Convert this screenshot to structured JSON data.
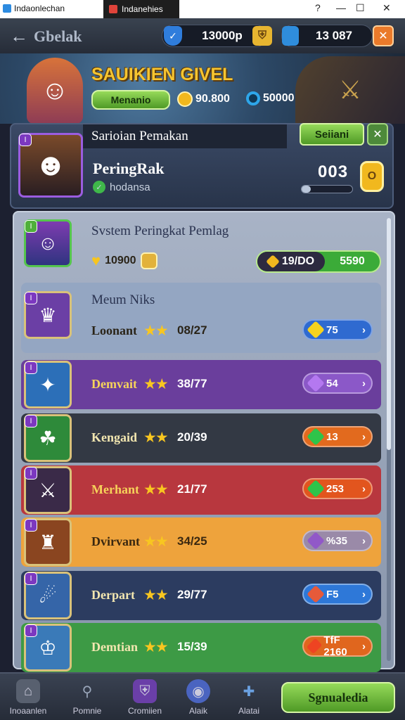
{
  "window": {
    "app_title": "Indaonlechan",
    "tab_title": "Indanehies",
    "help": "?",
    "minimize": "—",
    "maximize": "☐",
    "close": "✕"
  },
  "topbar": {
    "back_label": "Gbelak",
    "currency1": "13000p",
    "currency2": "13 087",
    "plus": "+",
    "close": "✕"
  },
  "hero": {
    "title": "SAUIKIEN GIVEL",
    "button": "Menanio",
    "gold": "90.800",
    "silver": "50000"
  },
  "profile": {
    "tab_title": "Sarioian Pemakan",
    "tab_button": "Seiiani",
    "name": "PeringRak",
    "status": "hodansa",
    "score": "003"
  },
  "list": {
    "title": "Svstem Peringkat Pemlag",
    "first": {
      "gold": "10900",
      "range": "19/DO",
      "green_value": "5590"
    },
    "section_title": "Meum Niks",
    "rows": [
      {
        "name": "Loonant",
        "value": "08/27",
        "badge": "75",
        "color": "#94a6c2",
        "badge_color": "#2f6ad0",
        "gem_color": "#f6d21e",
        "avatar": "♛",
        "avatar_bg": "#6b3fa5"
      },
      {
        "name": "Demvait",
        "value": "38/77",
        "badge": "54",
        "color": "#6a3e9c",
        "badge_color": "#8b58c8",
        "gem_color": "#b478f0",
        "avatar": "✦",
        "avatar_bg": "#2c6fb8"
      },
      {
        "name": "Kengaid",
        "value": "20/39",
        "badge": "13",
        "color": "#333944",
        "badge_color": "#e26a1e",
        "gem_color": "#2ec44a",
        "avatar": "☘",
        "avatar_bg": "#2e8a3a"
      },
      {
        "name": "Merhant",
        "value": "21/77",
        "badge": "253",
        "color": "#b8373e",
        "badge_color": "#e2551e",
        "gem_color": "#2ec44a",
        "avatar": "⚔",
        "avatar_bg": "#3a2a48"
      },
      {
        "name": "Dvirvant",
        "value": "34/25",
        "badge": "%35",
        "color": "#eea33c",
        "badge_color": "#9a8aa8",
        "gem_color": "#9158c8",
        "avatar": "♜",
        "avatar_bg": "#8a4520"
      },
      {
        "name": "Derpart",
        "value": "29/77",
        "badge": "F5",
        "color": "#2c3c60",
        "badge_color": "#2e78d8",
        "gem_color": "#e65a3a",
        "avatar": "☄",
        "avatar_bg": "#3565a8"
      },
      {
        "name": "Demtian",
        "value": "15/39",
        "badge": "TfF 2160",
        "color": "#3d9a45",
        "badge_color": "#e0661e",
        "gem_color": "#ee4422",
        "avatar": "♔",
        "avatar_bg": "#3a7ab8"
      }
    ]
  },
  "nav": {
    "items": [
      "Inoaanlen",
      "Pomnie",
      "Cromiien",
      "Alaik",
      "Alatai"
    ],
    "primary": "Sgnualedia"
  }
}
